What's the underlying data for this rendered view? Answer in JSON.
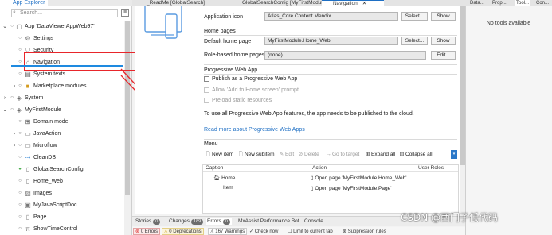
{
  "explorer": {
    "tab_label": "App Explorer",
    "search_placeholder": "Search...",
    "items": [
      {
        "label": "App 'DataViewerAppWeb97'"
      },
      {
        "label": "Settings"
      },
      {
        "label": "Security"
      },
      {
        "label": "Navigation"
      },
      {
        "label": "System texts"
      },
      {
        "label": "Marketplace modules"
      },
      {
        "label": "System"
      },
      {
        "label": "MyFirstModule"
      },
      {
        "label": "Domain model"
      },
      {
        "label": "JavaAction"
      },
      {
        "label": "Microflow"
      },
      {
        "label": "CleanDB"
      },
      {
        "label": "GlobalSearchConfig"
      },
      {
        "label": "Home_Web"
      },
      {
        "label": "Images"
      },
      {
        "label": "MyJavaScriptDoc"
      },
      {
        "label": "Page"
      },
      {
        "label": "ShowTimeControl"
      }
    ]
  },
  "tabs": [
    {
      "label": "_ReadMe [GlobalSearch]"
    },
    {
      "label": "GlobalSearchConfig [MyFirstModule]"
    },
    {
      "label": "Navigation"
    }
  ],
  "editor": {
    "app_icon_label": "Application icon",
    "app_icon_value": "Atlas_Core.Content.Mendix",
    "select_label": "Select...",
    "show_label": "Show",
    "home_pages_header": "Home pages",
    "default_home_label": "Default home page",
    "default_home_value": "MyFirstModule.Home_Web",
    "role_home_label": "Role-based home pages",
    "role_home_value": "(none)",
    "edit_label": "Edit...",
    "pwa_header": "Progressive Web App",
    "pwa_publish": "Publish as a Progressive Web App",
    "pwa_allow": "Allow 'Add to Home screen' prompt",
    "pwa_preload": "Preload static resources",
    "pwa_note": "To use all Progressive Web App features, the app needs to be published to the cloud.",
    "pwa_link": "Read more about Progressive Web Apps",
    "menu_header": "Menu",
    "toolbar": {
      "new_item": "New item",
      "new_subitem": "New subitem",
      "edit": "Edit",
      "delete": "Delete",
      "go_to_target": "Go to target",
      "expand_all": "Expand all",
      "collapse_all": "Collapse all"
    },
    "grid": {
      "headers": [
        "Caption",
        "Action",
        "User Roles"
      ],
      "rows": [
        {
          "caption": "Home",
          "action": "Open page 'MyFirstModule.Home_Web'"
        },
        {
          "caption": "Item",
          "action": "Open page 'MyFirstModule.Page'"
        }
      ]
    }
  },
  "bottom": {
    "tabs": [
      {
        "label": "Stories",
        "badge": "0"
      },
      {
        "label": "Changes",
        "badge": "189"
      },
      {
        "label": "Errors",
        "badge": "0"
      },
      {
        "label": "MxAssist Performance Bot"
      },
      {
        "label": "Console"
      }
    ],
    "filters": [
      {
        "label": "0 Errors"
      },
      {
        "label": "0 Deprecations"
      },
      {
        "label": "167 Warnings"
      },
      {
        "label": "Check now"
      },
      {
        "label": "Limit to current tab"
      },
      {
        "label": "Suppression rules"
      }
    ]
  },
  "right_panel": {
    "tabs": [
      "Data...",
      "Prop...",
      "Tool...",
      "Con..."
    ],
    "no_tools": "No tools available"
  },
  "watermark": "CSDN @西门子低代码",
  "colors": {
    "accent": "#1e6fc4",
    "highlight_box": "#e8262b",
    "selection": "#cfe3f6"
  }
}
